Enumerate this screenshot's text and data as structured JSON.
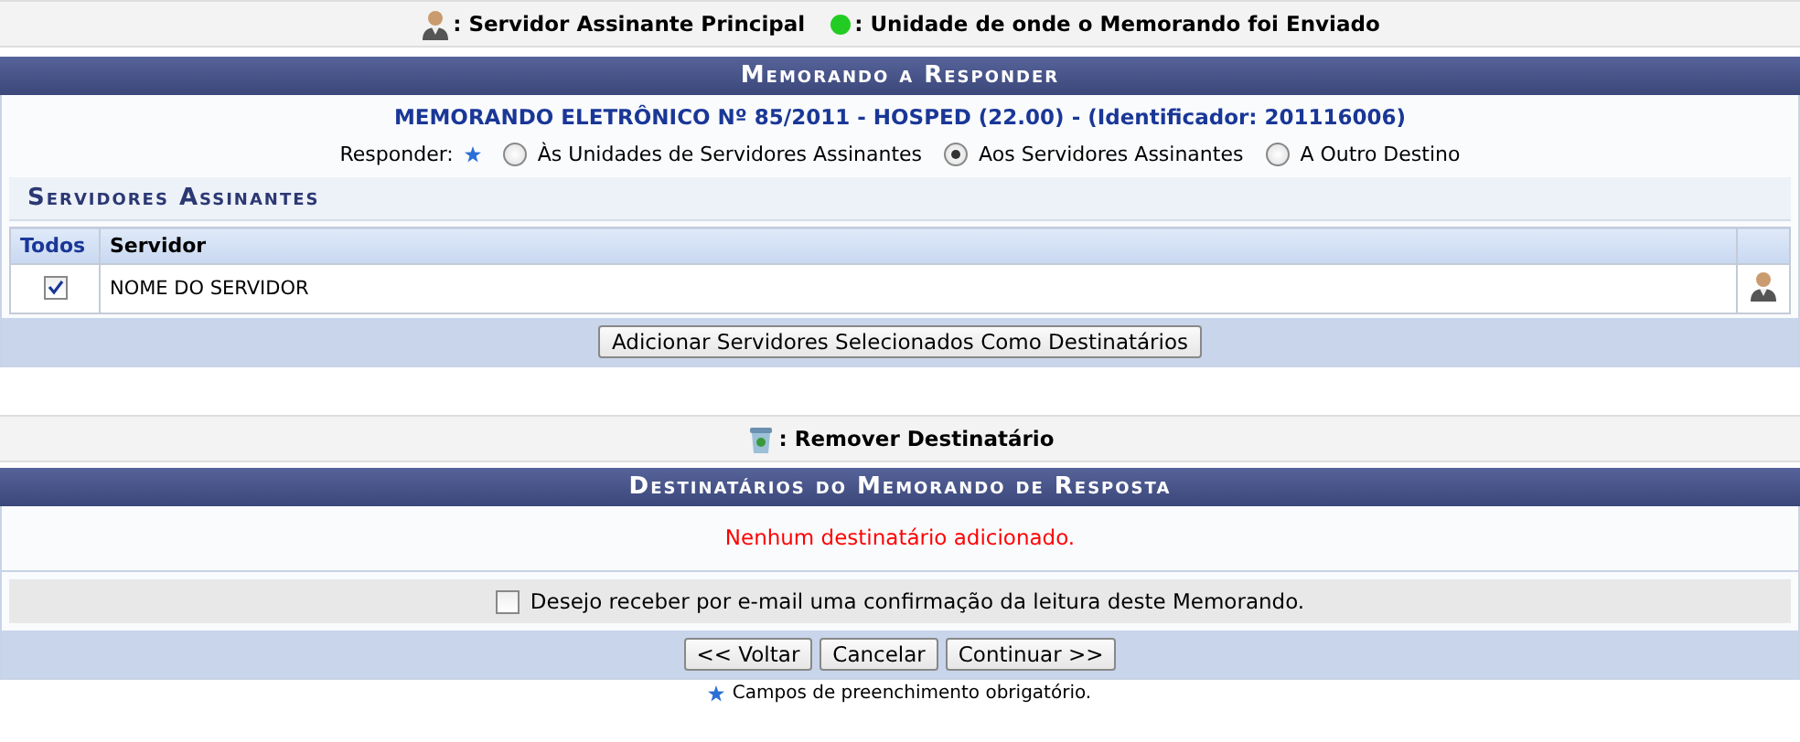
{
  "legend_top": [
    {
      "kind": "person",
      "label": ": Servidor Assinante Principal"
    },
    {
      "kind": "dot",
      "label": ": Unidade de onde o Memorando foi Enviado",
      "color": "#22cc22"
    }
  ],
  "memo_panel": {
    "title": "Memorando a Responder",
    "memo_heading": "MEMORANDO ELETRÔNICO Nº 85/2011 - HOSPED (22.00) - (Identificador: 201116006)",
    "responder_label": "Responder:",
    "options": [
      {
        "label": "Às Unidades de Servidores Assinantes",
        "selected": false
      },
      {
        "label": "Aos Servidores Assinantes",
        "selected": true
      },
      {
        "label": "A Outro Destino",
        "selected": false
      }
    ],
    "subsection_title": "Servidores Assinantes",
    "table": {
      "columns": [
        "Todos",
        "Servidor"
      ],
      "rows": [
        {
          "checked": true,
          "servidor": "NOME DO SERVIDOR",
          "principal": true
        }
      ]
    },
    "add_button": "Adicionar Servidores Selecionados Como Destinatários"
  },
  "legend_bottom": {
    "label": ": Remover Destinatário"
  },
  "recipients_panel": {
    "title": "Destinatários do Memorando de Resposta",
    "empty_message": "Nenhum destinatário adicionado.",
    "confirm_checkbox": {
      "label": "Desejo receber por e-mail uma confirmação da leitura deste Memorando.",
      "checked": false
    }
  },
  "buttons": [
    "<< Voltar",
    "Cancelar",
    "Continuar >>"
  ],
  "footnote": "Campos de preenchimento obrigatório."
}
